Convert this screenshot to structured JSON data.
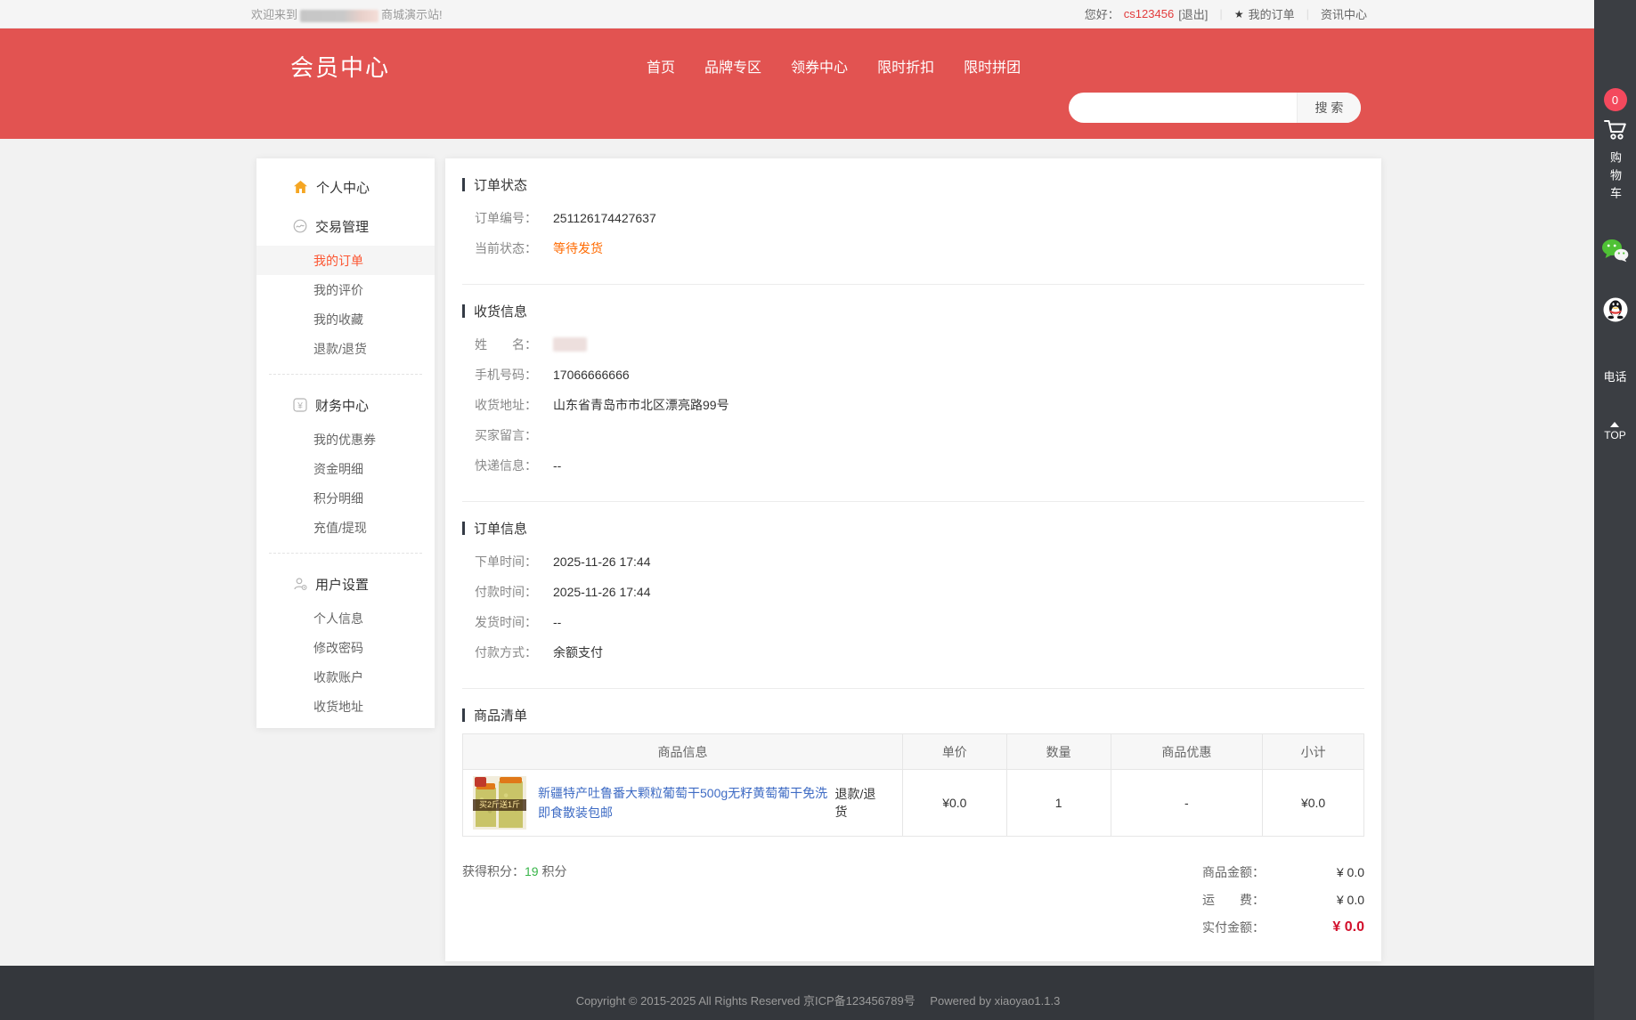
{
  "topbar": {
    "welcome_prefix": "欢迎来到",
    "welcome_suffix": "商城演示站!",
    "greeting_label": "您好：",
    "username": "cs123456",
    "logout_label": "[退出]",
    "my_orders_label": "我的订单",
    "news_label": "资讯中心"
  },
  "header": {
    "title": "会员中心",
    "nav": [
      "首页",
      "品牌专区",
      "领券中心",
      "限时折扣",
      "限时拼团"
    ],
    "search_button_label": "搜 索"
  },
  "floatbar": {
    "cart_badge": "0",
    "cart_label": "购物车",
    "phone_label": "电话",
    "top_label": "TOP"
  },
  "sidebar": {
    "groups": [
      {
        "title": "个人中心",
        "icon": "home-icon",
        "items": []
      },
      {
        "title": "交易管理",
        "icon": "trade-icon",
        "items": [
          {
            "label": "我的订单",
            "active": true
          },
          {
            "label": "我的评价"
          },
          {
            "label": "我的收藏"
          },
          {
            "label": "退款/退货"
          }
        ]
      },
      {
        "title": "财务中心",
        "icon": "finance-icon",
        "items": [
          {
            "label": "我的优惠券"
          },
          {
            "label": "资金明细"
          },
          {
            "label": "积分明细"
          },
          {
            "label": "充值/提现"
          }
        ]
      },
      {
        "title": "用户设置",
        "icon": "user-settings-icon",
        "items": [
          {
            "label": "个人信息"
          },
          {
            "label": "修改密码"
          },
          {
            "label": "收款账户"
          },
          {
            "label": "收货地址"
          }
        ]
      }
    ]
  },
  "order_status": {
    "section_title": "订单状态",
    "rows": [
      {
        "label": "订单编号：",
        "value": "251126174427637"
      },
      {
        "label": "当前状态：",
        "value": "等待发货"
      }
    ]
  },
  "shipping": {
    "section_title": "收货信息",
    "rows": [
      {
        "label": "姓　　名：",
        "value": "",
        "redacted": true
      },
      {
        "label": "手机号码：",
        "value": "17066666666"
      },
      {
        "label": "收货地址：",
        "value": "山东省青岛市市北区漂亮路99号"
      },
      {
        "label": "买家留言：",
        "value": ""
      },
      {
        "label": "快递信息：",
        "value": "--"
      }
    ]
  },
  "order_info": {
    "section_title": "订单信息",
    "rows": [
      {
        "label": "下单时间：",
        "value": "2025-11-26 17:44"
      },
      {
        "label": "付款时间：",
        "value": "2025-11-26 17:44"
      },
      {
        "label": "发货时间：",
        "value": "--"
      },
      {
        "label": "付款方式：",
        "value": "余额支付"
      }
    ]
  },
  "items": {
    "section_title": "商品清单",
    "table": {
      "headers": [
        "商品信息",
        "单价",
        "数量",
        "商品优惠",
        "小计"
      ],
      "rows": [
        {
          "product_title": "新疆特产吐鲁番大颗粒葡萄干500g无籽黄萄葡干免洗即食散装包邮",
          "image_badge": "买2斤送1斤",
          "refund_label": "退款/退货",
          "unit_price": "¥0.0",
          "quantity": "1",
          "discount": "-",
          "subtotal": "¥0.0"
        }
      ]
    },
    "points_label": "获得积分：",
    "points_value": "19",
    "points_unit": " 积分",
    "totals": [
      {
        "label": "商品金额：",
        "value": "¥ 0.0"
      },
      {
        "label": "运　　费：",
        "value": "¥ 0.0"
      },
      {
        "label": "实付金额：",
        "value": "¥ 0.0",
        "emphasis": true
      }
    ]
  },
  "footer": {
    "copyright": "Copyright © 2015-2025 All Rights Reserved 京ICP备123456789号　 Powered by xiaoyao1.1.3"
  },
  "colors": {
    "header_red": "#e25351",
    "active_item_orange": "#fc5531",
    "status_orange": "#ff6a00",
    "link_blue": "#3e6bc4",
    "points_green": "#39b54a",
    "amount_red": "#d2102c",
    "cart_badge_red": "#f4495d",
    "footer_dark": "#34373c",
    "floatbar_dark": "#3b3e43"
  }
}
